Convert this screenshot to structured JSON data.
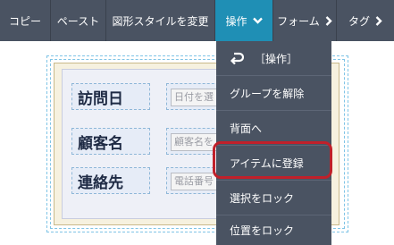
{
  "toolbar": {
    "buttons": [
      {
        "label": "コピー"
      },
      {
        "label": "ペースト"
      },
      {
        "label": "図形スタイルを変更"
      },
      {
        "label": "操作",
        "chevron": "chevron-down-icon",
        "active": true
      },
      {
        "label": "フォーム",
        "chevron": "chevron-right-icon"
      },
      {
        "label": "タグ",
        "chevron": "chevron-right-icon"
      }
    ]
  },
  "form": {
    "fields": [
      {
        "label": "訪問日",
        "placeholder": "日付を選"
      },
      {
        "label": "顧客名",
        "placeholder": "顧客名を"
      },
      {
        "label": "連絡先",
        "placeholder": "電話番号"
      }
    ]
  },
  "menu": {
    "header": "［操作］",
    "header_icon": "back-arrow-icon",
    "items": [
      {
        "label": "グループを解除"
      },
      {
        "label": "背面へ"
      },
      {
        "label": "アイテムに登録",
        "highlighted": true
      },
      {
        "label": "選択をロック"
      },
      {
        "label": "位置をロック"
      }
    ]
  },
  "colors": {
    "toolbar_bg": "#4a5362",
    "active_bg": "#1f8fb5",
    "highlight_ring": "#c0202a",
    "selection_dash": "#7fc4e6"
  }
}
